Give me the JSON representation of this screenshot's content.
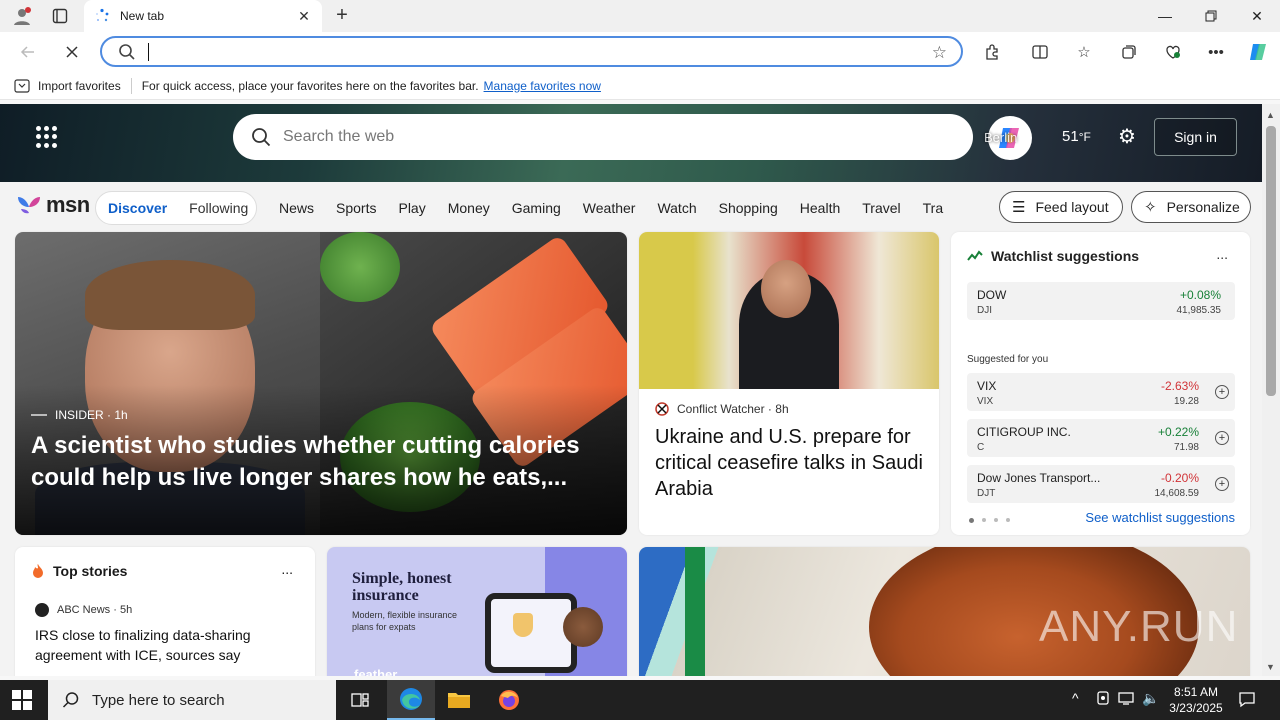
{
  "browser": {
    "tab_title": "New tab",
    "favorites_bar": {
      "import_label": "Import favorites",
      "message": "For quick access, place your favorites here on the favorites bar.",
      "link": "Manage favorites now"
    },
    "address_value": ""
  },
  "msn": {
    "search_placeholder": "Search the web",
    "copilot_text": "Berlin",
    "temperature": "51",
    "temperature_unit": "°F",
    "signin": "Sign in",
    "logo_text": "msn",
    "segment": {
      "active": "Discover",
      "other": "Following"
    },
    "nav_links": [
      "News",
      "Sports",
      "Play",
      "Money",
      "Gaming",
      "Weather",
      "Watch",
      "Shopping",
      "Health",
      "Travel",
      "Tra"
    ],
    "feed_layout": "Feed layout",
    "personalize": "Personalize",
    "hero_story": {
      "source": "INSIDER",
      "age": "1h",
      "title": "A scientist who studies whether cutting calories could help us live longer shares how he eats,..."
    },
    "second_story": {
      "source": "Conflict Watcher",
      "age": "8h",
      "title": "Ukraine and U.S. prepare for critical ceasefire talks in Saudi Arabia"
    },
    "watchlist": {
      "title": "Watchlist suggestions",
      "more": "...",
      "main": {
        "name": "DOW",
        "symbol": "DJI",
        "change": "+0.08%",
        "price": "41,985.35"
      },
      "suggested_label": "Suggested for you",
      "suggestions": [
        {
          "name": "VIX",
          "symbol": "VIX",
          "change": "-2.63%",
          "price": "19.28"
        },
        {
          "name": "CITIGROUP INC.",
          "symbol": "C",
          "change": "+0.22%",
          "price": "71.98"
        },
        {
          "name": "Dow Jones Transport...",
          "symbol": "DJT",
          "change": "-0.20%",
          "price": "14,608.59"
        }
      ],
      "see_all": "See watchlist suggestions"
    },
    "top_stories": {
      "title": "Top stories",
      "more": "...",
      "source": "ABC News",
      "age": "5h",
      "headline": "IRS close to finalizing data-sharing agreement with ICE, sources say"
    },
    "ad": {
      "headline": "Simple, honest insurance",
      "subtext": "Modern, flexible insurance plans for expats",
      "brand": "feather"
    },
    "watermark": "ANY.RUN"
  },
  "taskbar": {
    "search_placeholder": "Type here to search",
    "time": "8:51 AM",
    "date": "3/23/2025"
  },
  "colors": {
    "accent": "#0f5fc9",
    "positive": "#188038",
    "negative": "#d13438"
  }
}
